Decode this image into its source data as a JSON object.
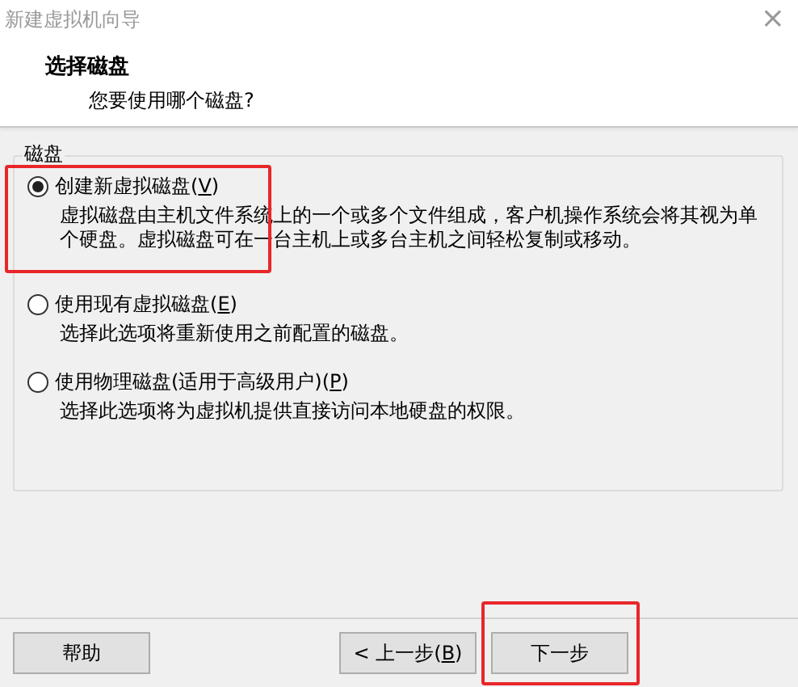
{
  "window": {
    "title": "新建虚拟机向导",
    "close": "×"
  },
  "header": {
    "title": "选择磁盘",
    "subtitle": "您要使用哪个磁盘?"
  },
  "group": {
    "label": "磁盘",
    "options": [
      {
        "label_parts": [
          "创建新虚拟磁盘(",
          "V",
          ")"
        ],
        "description": "虚拟磁盘由主机文件系统上的一个或多个文件组成，客户机操作系统会将其视为单个硬盘。虚拟磁盘可在一台主机上或多台主机之间轻松复制或移动。",
        "selected": true,
        "highlighted": true
      },
      {
        "label_parts": [
          "使用现有虚拟磁盘(",
          "E",
          ")"
        ],
        "description": "选择此选项将重新使用之前配置的磁盘。",
        "selected": false,
        "highlighted": false
      },
      {
        "label_parts": [
          "使用物理磁盘(适用于高级用户)(",
          "P",
          ")"
        ],
        "description": "选择此选项将为虚拟机提供直接访问本地硬盘的权限。",
        "selected": false,
        "highlighted": false
      }
    ]
  },
  "buttons": [
    {
      "kind": "help",
      "label_parts": [
        "帮助"
      ],
      "highlighted": false
    },
    {
      "kind": "back",
      "label_parts": [
        "< 上一步(",
        "B",
        ")"
      ],
      "highlighted": false
    },
    {
      "kind": "next",
      "label_parts": [
        "下一步"
      ],
      "highlighted": true
    }
  ]
}
